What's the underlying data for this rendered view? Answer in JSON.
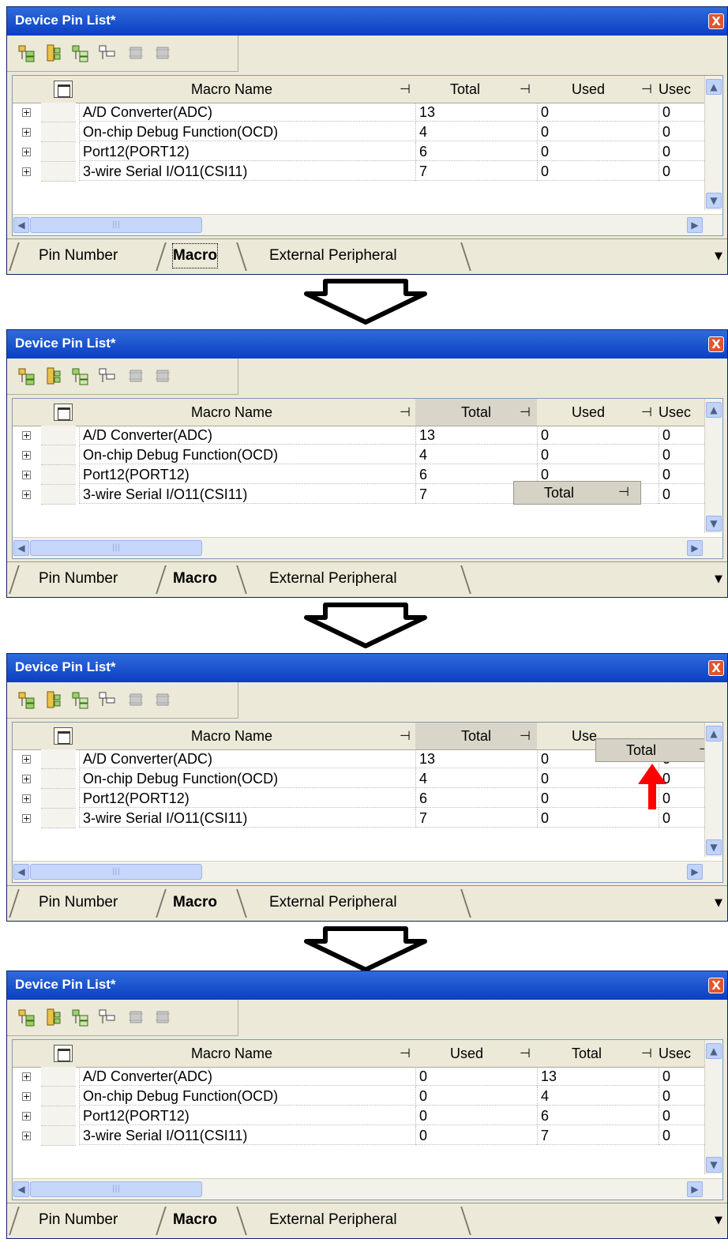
{
  "window_title": "Device Pin List*",
  "close_glyph": "X",
  "toolbar_icons": [
    "expand-all-icon",
    "collapse-all-icon",
    "expand-selected-icon",
    "collapse-selected-icon",
    "chip-disabled-icon",
    "chip-gray-icon"
  ],
  "header": {
    "macro_name": "Macro Name",
    "total": "Total",
    "used": "Used",
    "used_truncated": "Usec",
    "used_partial": "Use",
    "pin_glyph": "⊣"
  },
  "rows": [
    {
      "macro": "A/D Converter(ADC)",
      "total": "13",
      "used": "0",
      "used2": "0"
    },
    {
      "macro": "On-chip Debug Function(OCD)",
      "total": "4",
      "used": "0",
      "used2": "0"
    },
    {
      "macro": "Port12(PORT12)",
      "total": "6",
      "used": "0",
      "used2": "0"
    },
    {
      "macro": "3-wire Serial I/O11(CSI11)",
      "total": "7",
      "used": "0",
      "used2": "0"
    }
  ],
  "tabs": {
    "pin_number": "Pin Number",
    "macro": "Macro",
    "external": "External Peripheral"
  },
  "drag_label": "Total",
  "colors": {
    "title_bar": "#0a3fc2",
    "highlight_arrow": "#ff0000"
  }
}
